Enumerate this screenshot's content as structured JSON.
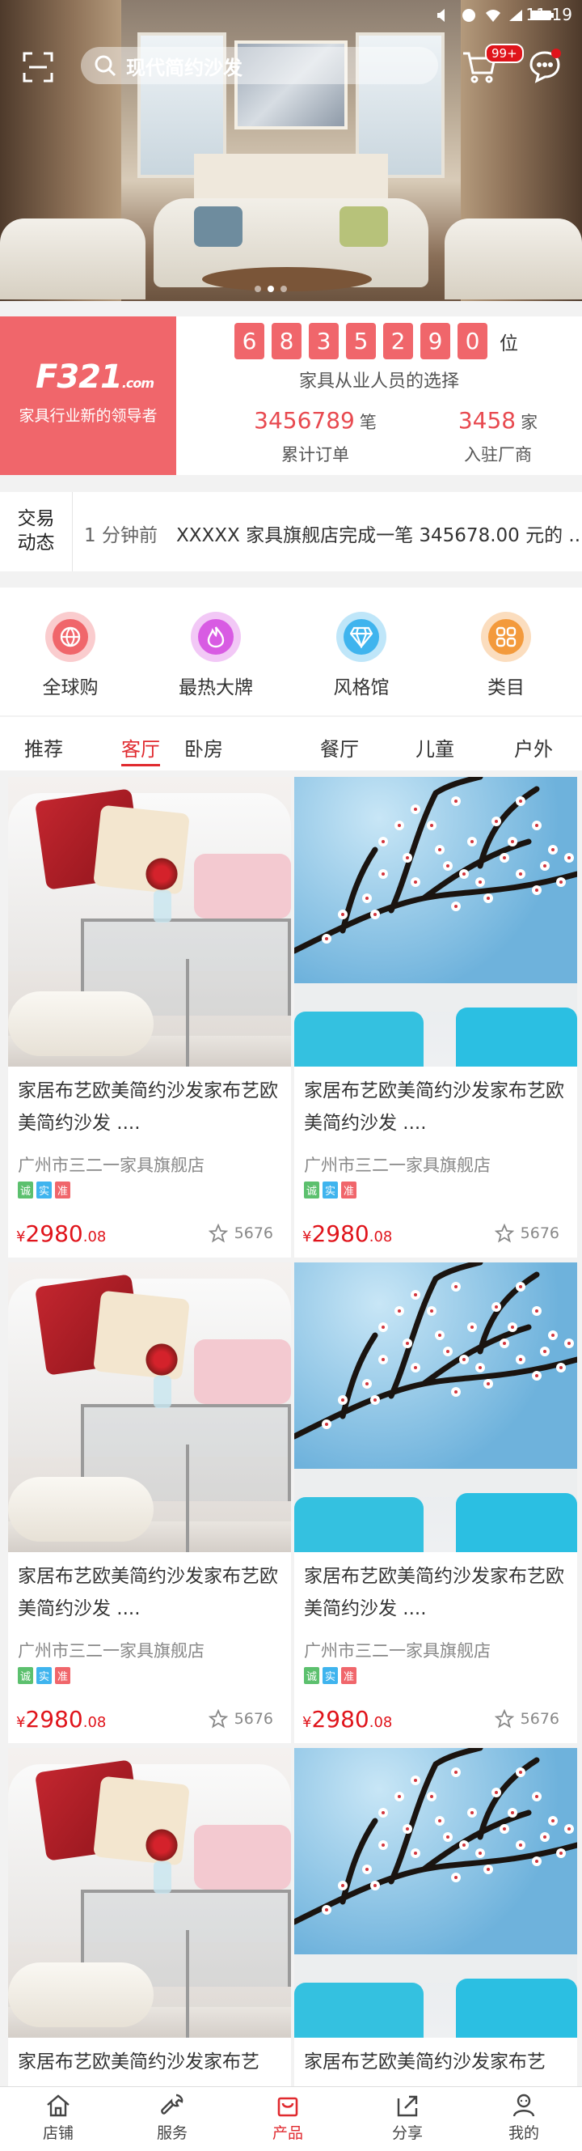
{
  "status_bar": {
    "time": "11:19"
  },
  "search": {
    "query": "现代简约沙发"
  },
  "cart": {
    "badge": "99+"
  },
  "stats": {
    "brand_logo": "F321",
    "brand_logo_suffix": ".com",
    "brand_slogan": "家具行业新的领导者",
    "counter_digits": [
      "6",
      "8",
      "3",
      "5",
      "2",
      "9",
      "0"
    ],
    "counter_unit": "位",
    "counter_caption": "家具从业人员的选择",
    "orders_value": "3456789",
    "orders_unit": "笔",
    "orders_label": "累计订单",
    "vendors_value": "3458",
    "vendors_unit": "家",
    "vendors_label": "入驻厂商"
  },
  "news": {
    "tag_line1": "交易",
    "tag_line2": "动态",
    "time": "1 分钟前",
    "text": "XXXXX 家具旗舰店完成一笔 345678.00 元的 .."
  },
  "quick_nav": [
    {
      "label": "全球购",
      "icon": "globe-icon",
      "color": "#f0666b"
    },
    {
      "label": "最热大牌",
      "icon": "fire-icon",
      "color": "#d85be3"
    },
    {
      "label": "风格馆",
      "icon": "diamond-icon",
      "color": "#3fb4ee"
    },
    {
      "label": "类目",
      "icon": "grid-icon",
      "color": "#f39a3c"
    }
  ],
  "category_tabs": [
    "推荐",
    "客厅",
    "卧房",
    "餐厅",
    "儿童",
    "户外"
  ],
  "active_tab": "客厅",
  "products": [
    {
      "image": "sofa",
      "name": "家居布艺欧美简约沙发家布艺欧美简约沙发 ....",
      "shop": "广州市三二一家具旗舰店",
      "tags": [
        "诚",
        "实",
        "准"
      ],
      "currency": "¥",
      "price_int": "2980",
      "price_dec": ".08",
      "favs": "5676"
    },
    {
      "image": "blossom",
      "name": "家居布艺欧美简约沙发家布艺欧美简约沙发 ....",
      "shop": "广州市三二一家具旗舰店",
      "tags": [
        "诚",
        "实",
        "准"
      ],
      "currency": "¥",
      "price_int": "2980",
      "price_dec": ".08",
      "favs": "5676"
    },
    {
      "image": "sofa",
      "name": "家居布艺欧美简约沙发家布艺欧美简约沙发 ....",
      "shop": "广州市三二一家具旗舰店",
      "tags": [
        "诚",
        "实",
        "准"
      ],
      "currency": "¥",
      "price_int": "2980",
      "price_dec": ".08",
      "favs": "5676"
    },
    {
      "image": "blossom",
      "name": "家居布艺欧美简约沙发家布艺欧美简约沙发 ....",
      "shop": "广州市三二一家具旗舰店",
      "tags": [
        "诚",
        "实",
        "准"
      ],
      "currency": "¥",
      "price_int": "2980",
      "price_dec": ".08",
      "favs": "5676"
    },
    {
      "image": "sofa",
      "name": "家居布艺欧美简约沙发家布艺",
      "shop": "",
      "tags": [],
      "currency": "",
      "price_int": "",
      "price_dec": "",
      "favs": ""
    },
    {
      "image": "blossom",
      "name": "家居布艺欧美简约沙发家布艺",
      "shop": "",
      "tags": [],
      "currency": "",
      "price_int": "",
      "price_dec": "",
      "favs": ""
    }
  ],
  "tag_colors": [
    "#5cc06e",
    "#3fb4ee",
    "#f0666b"
  ],
  "bottom_nav": [
    {
      "label": "店铺",
      "icon": "home-icon"
    },
    {
      "label": "服务",
      "icon": "wrench-icon"
    },
    {
      "label": "产品",
      "icon": "shopping-bag-icon"
    },
    {
      "label": "分享",
      "icon": "share-icon"
    },
    {
      "label": "我的",
      "icon": "user-icon"
    }
  ],
  "active_bottom": "产品",
  "colors": {
    "accent": "#e02a2f",
    "brand": "#f0666b",
    "price": "#e0141b"
  }
}
